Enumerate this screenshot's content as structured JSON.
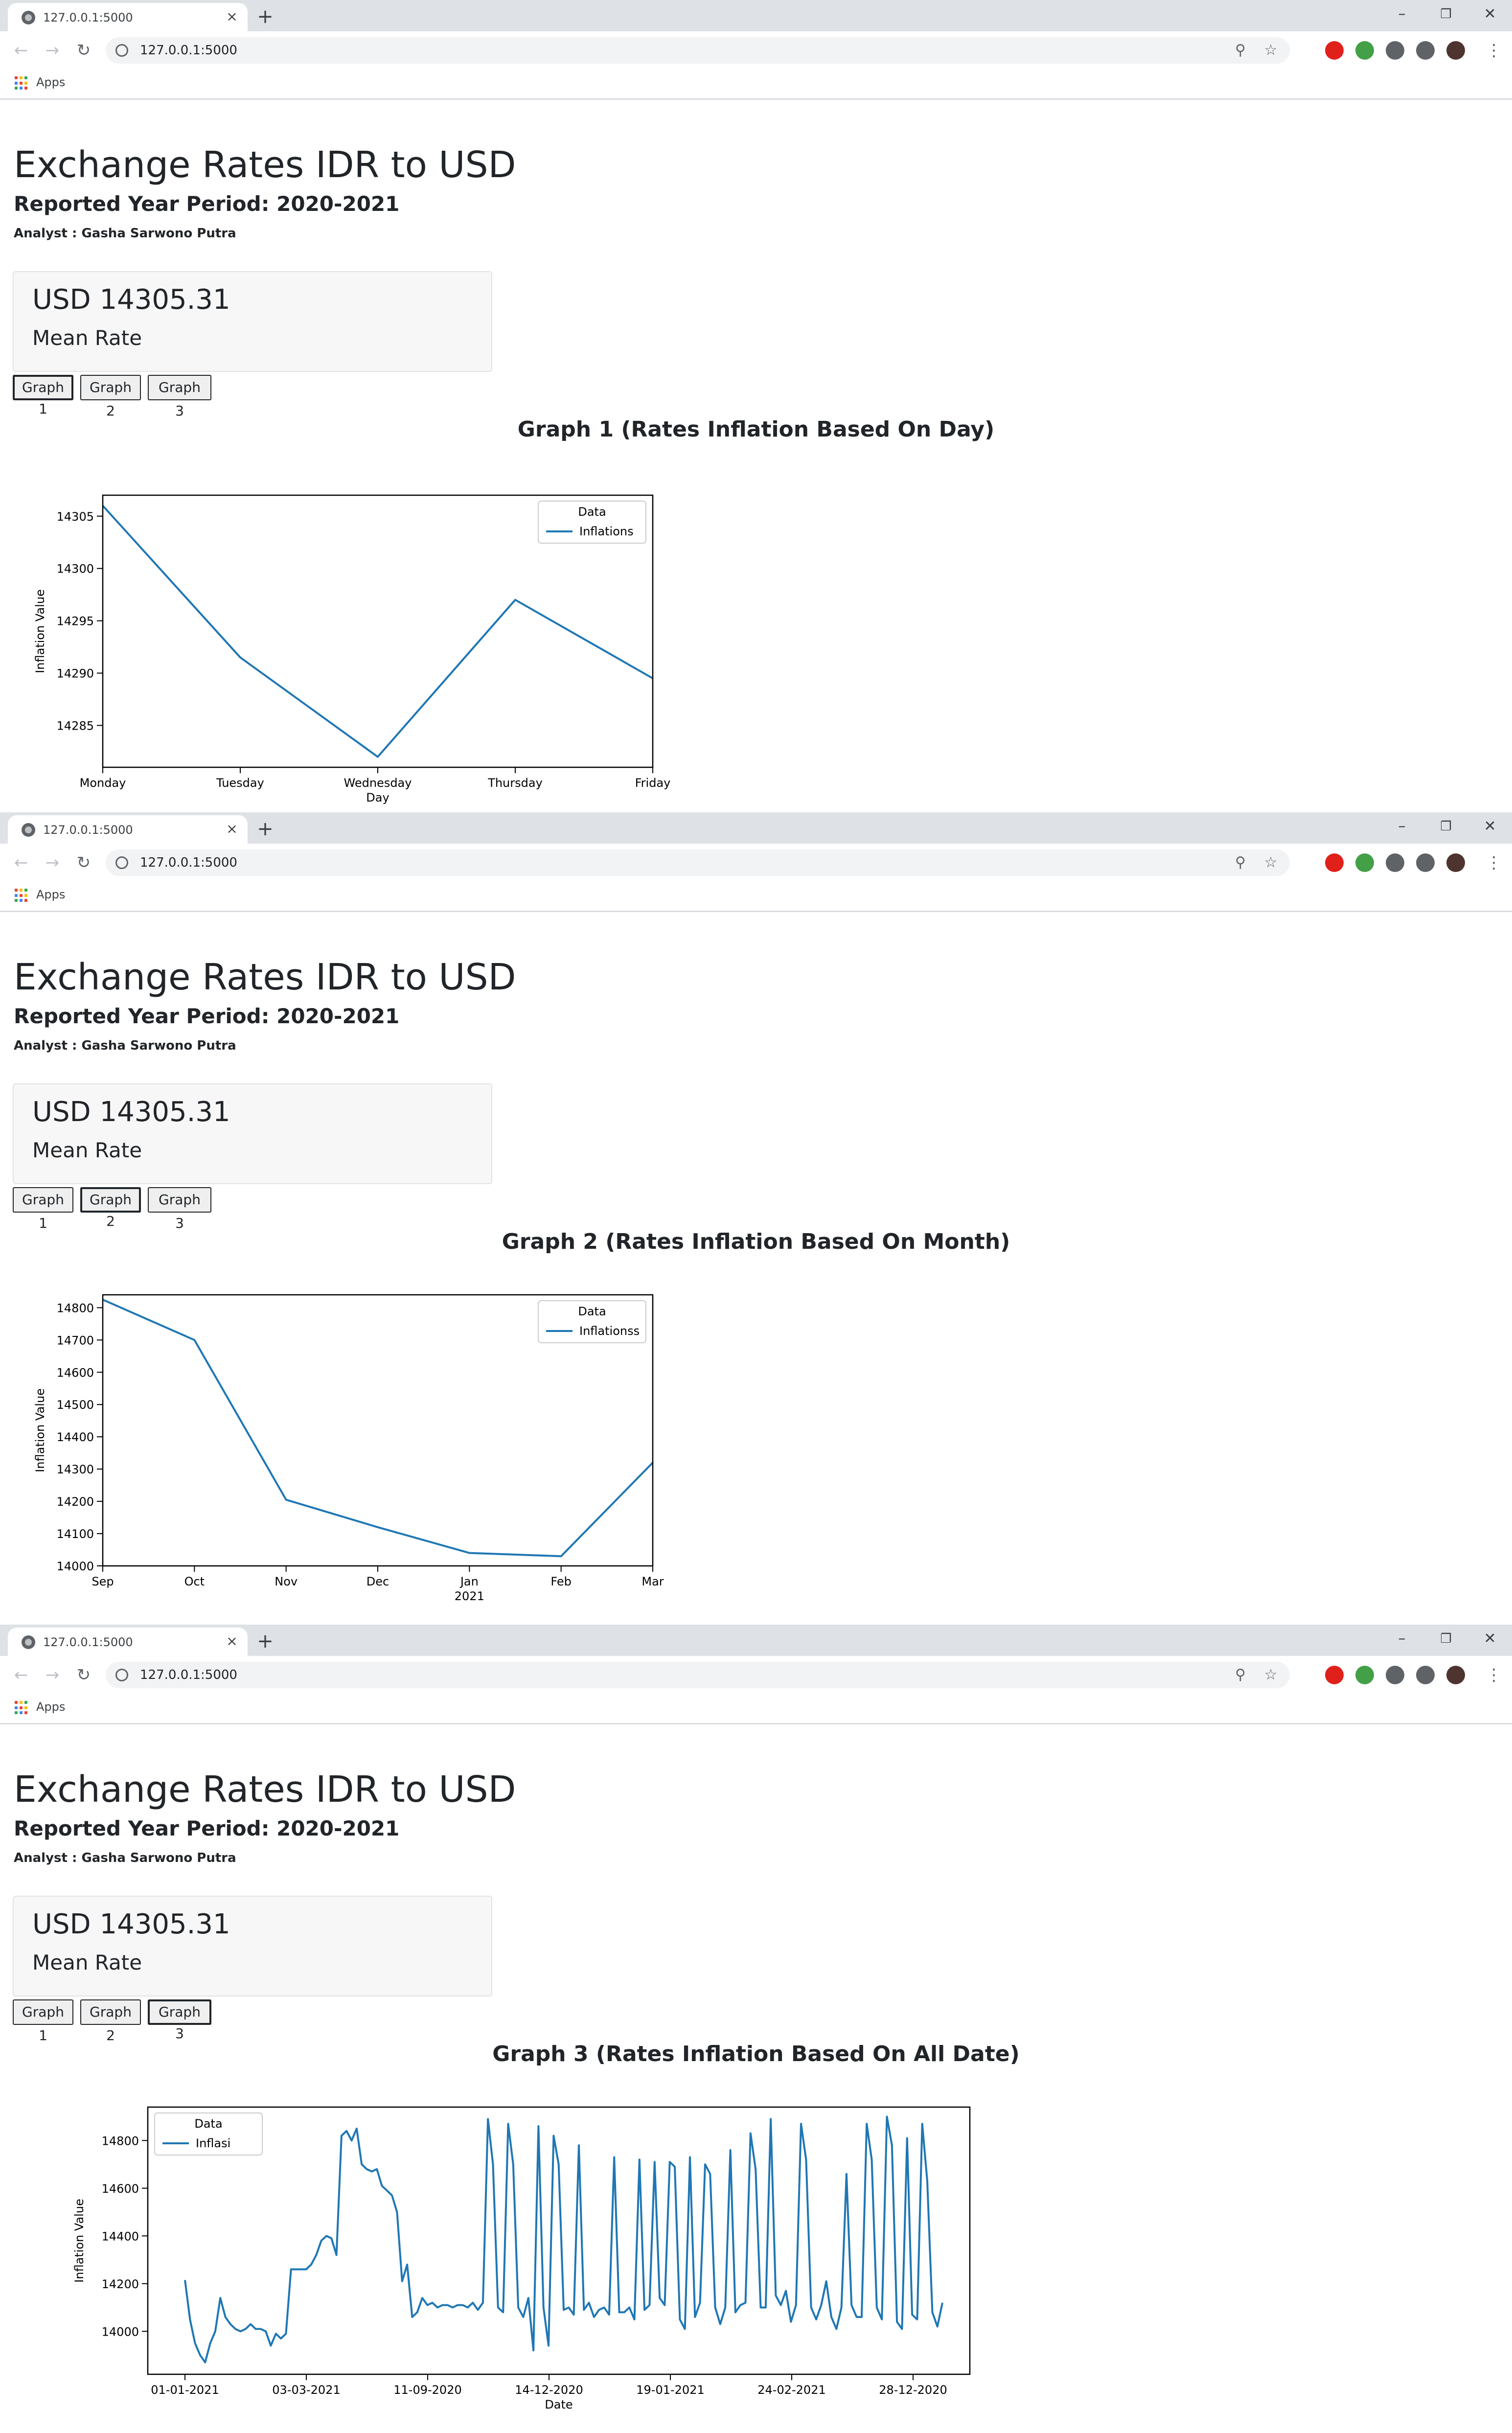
{
  "browser": {
    "tab_title": "127.0.0.1:5000",
    "url": "127.0.0.1:5000",
    "bookmarks_apps_label": "Apps",
    "new_tab_glyph": "+",
    "close_glyph": "×"
  },
  "header": {
    "title": "Exchange Rates IDR to USD",
    "period": "Reported Year Period: 2020-2021",
    "analyst": "Analyst : Gasha Sarwono Putra"
  },
  "card": {
    "amount": "USD 14305.31",
    "label": "Mean Rate"
  },
  "buttons": [
    "Graph 1",
    "Graph 2",
    "Graph 3"
  ],
  "screens": [
    {
      "active_button": 0,
      "heading": "Graph 1 (Rates Inflation Based On Day)"
    },
    {
      "active_button": 1,
      "heading": "Graph 2 (Rates Inflation Based On Month)"
    },
    {
      "active_button": 2,
      "heading": "Graph 3 (Rates Inflation Based On All Date)"
    }
  ],
  "chart_data": [
    {
      "type": "line",
      "x": [
        "Monday",
        "Tuesday",
        "Wednesday",
        "Thursday",
        "Friday"
      ],
      "series": [
        {
          "name": "Inflations",
          "values": [
            14306,
            14291.5,
            14282,
            14297,
            14289.5
          ],
          "color": "#1f77b4"
        }
      ],
      "xlabel": "Day",
      "ylabel": "Inflation Value",
      "ylim": [
        14281,
        14307
      ],
      "yticks": [
        14285,
        14290,
        14295,
        14300,
        14305
      ],
      "legend_title": "Data",
      "legend_position": "top-right"
    },
    {
      "type": "line",
      "x": [
        "Sep",
        "Oct",
        "Nov",
        "Dec",
        "Jan",
        "Feb",
        "Mar"
      ],
      "x_sublabel": {
        "Jan": "2021"
      },
      "series": [
        {
          "name": "Inflationss",
          "values": [
            14825,
            14700,
            14205,
            14120,
            14040,
            14030,
            14320
          ],
          "color": "#1f77b4"
        }
      ],
      "xlabel": "",
      "ylabel": "Inflation Value",
      "ylim": [
        14000,
        14840
      ],
      "yticks": [
        14000,
        14100,
        14200,
        14300,
        14400,
        14500,
        14600,
        14700,
        14800
      ],
      "legend_title": "Data",
      "legend_position": "top-right"
    },
    {
      "type": "line",
      "xticks": [
        "01-01-2021",
        "03-03-2021",
        "11-09-2020",
        "14-12-2020",
        "19-01-2021",
        "24-02-2021",
        "28-12-2020"
      ],
      "series": [
        {
          "name": "Inflasi",
          "color": "#1f77b4",
          "values": [
            14215,
            14050,
            13950,
            13900,
            13870,
            13950,
            14000,
            14140,
            14060,
            14030,
            14010,
            14000,
            14010,
            14030,
            14010,
            14010,
            14000,
            13940,
            13990,
            13970,
            13990,
            14260,
            14260,
            14260,
            14260,
            14280,
            14320,
            14380,
            14400,
            14390,
            14320,
            14820,
            14840,
            14800,
            14850,
            14700,
            14680,
            14670,
            14680,
            14610,
            14590,
            14570,
            14500,
            14210,
            14280,
            14060,
            14080,
            14140,
            14110,
            14120,
            14100,
            14110,
            14110,
            14100,
            14110,
            14110,
            14100,
            14120,
            14090,
            14120,
            14890,
            14700,
            14100,
            14080,
            14870,
            14700,
            14100,
            14060,
            14140,
            13920,
            14860,
            14100,
            13940,
            14820,
            14700,
            14090,
            14100,
            14070,
            14780,
            14090,
            14120,
            14060,
            14090,
            14100,
            14070,
            14730,
            14080,
            14080,
            14100,
            14050,
            14720,
            14090,
            14110,
            14710,
            14140,
            14110,
            14710,
            14690,
            14050,
            14010,
            14730,
            14060,
            14120,
            14700,
            14660,
            14100,
            14030,
            14100,
            14760,
            14080,
            14110,
            14120,
            14830,
            14680,
            14100,
            14100,
            14890,
            14150,
            14110,
            14170,
            14040,
            14110,
            14870,
            14720,
            14100,
            14050,
            14110,
            14210,
            14060,
            14010,
            14100,
            14660,
            14110,
            14060,
            14060,
            14870,
            14720,
            14100,
            14050,
            14900,
            14780,
            14040,
            14010,
            14810,
            14070,
            14050,
            14870,
            14630,
            14080,
            14020,
            14120
          ]
        }
      ],
      "xlabel": "Date",
      "ylabel": "Inflation Value",
      "ylim": [
        13820,
        14940
      ],
      "yticks": [
        14000,
        14200,
        14400,
        14600,
        14800
      ],
      "legend_title": "Data",
      "legend_position": "top-left"
    }
  ],
  "icons": {
    "back": "arrow-left-icon",
    "forward": "arrow-right-icon",
    "reload": "reload-icon",
    "info": "info-icon",
    "zoom": "zoom-icon",
    "star": "star-icon",
    "menu": "kebab-menu-icon"
  }
}
